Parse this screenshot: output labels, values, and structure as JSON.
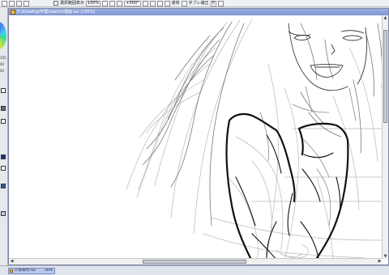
{
  "toolbar": {
    "checkbox_label": "選択範囲表示",
    "zoom_value": "100%",
    "angle_value": "+000°",
    "blend_mode": "通常",
    "correction_label": "手ブレ補正",
    "correction_value": "0"
  },
  "left_panel": {
    "numbers": [
      "105",
      "00",
      "00"
    ]
  },
  "window": {
    "title": "E:/drawing/作業/sketch/描画.sai (100%)"
  },
  "bottom": {
    "tab_label": "にお帯付.sai",
    "tab_zoom": "50%"
  }
}
